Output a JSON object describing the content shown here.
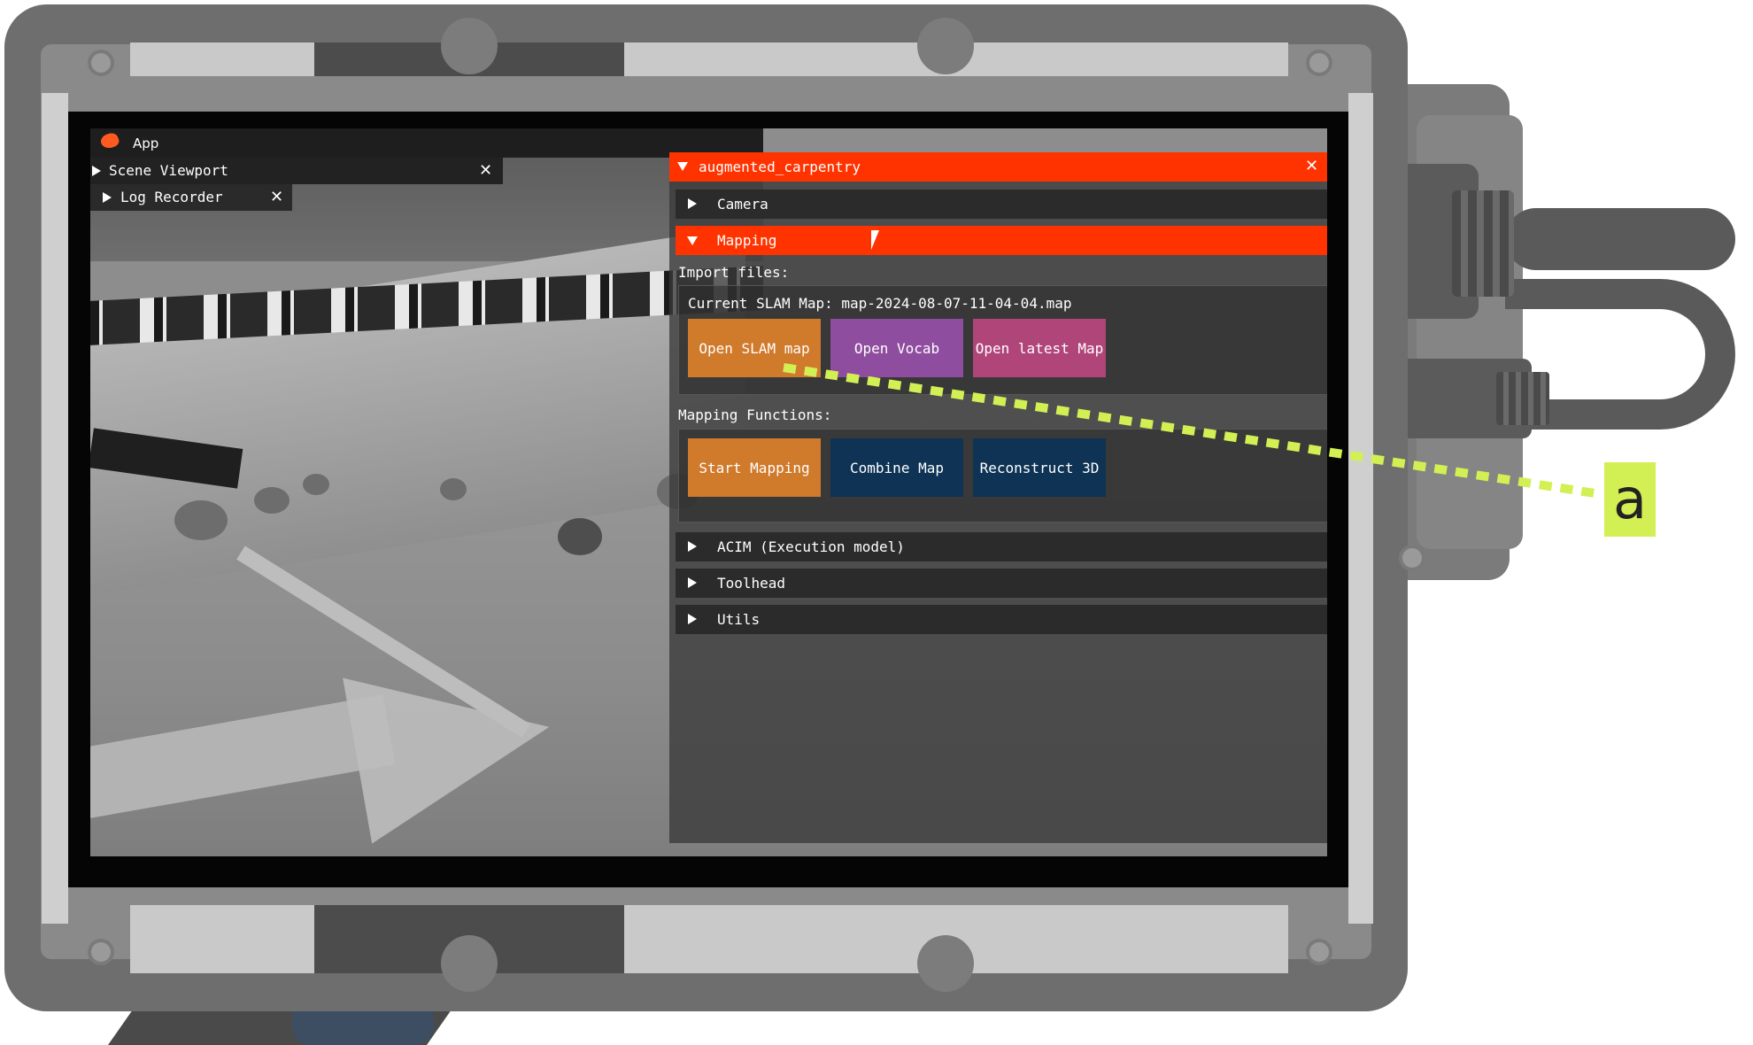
{
  "app_window": {
    "title": "App",
    "tabs": [
      {
        "label": "Scene Viewport",
        "close": "✕"
      },
      {
        "label": "Log Recorder",
        "close": "✕"
      }
    ]
  },
  "panel": {
    "title": "augmented_carpentry",
    "close": "✕",
    "sections": {
      "camera": "Camera",
      "mapping": "Mapping",
      "acim": "ACIM (Execution model)",
      "toolhead": "Toolhead",
      "utils": "Utils"
    },
    "mapping": {
      "import_label": "Import files:",
      "current_map": "Current SLAM Map: map-2024-08-07-11-04-04.map",
      "import_buttons": [
        {
          "label": "Open SLAM map",
          "color": "#d07a2c"
        },
        {
          "label": "Open Vocab",
          "color": "#8e4d9e"
        },
        {
          "label": "Open latest Map",
          "color": "#b0457a"
        }
      ],
      "functions_label": "Mapping Functions:",
      "function_buttons": [
        {
          "label": "Start Mapping",
          "color": "#d07a2c"
        },
        {
          "label": "Combine Map",
          "color": "#0e3355"
        },
        {
          "label": "Reconstruct 3D",
          "color": "#0e3355"
        }
      ]
    }
  },
  "annotation": {
    "label": "a",
    "color": "#d2ef54"
  },
  "colors": {
    "accent": "#ff3300",
    "housing": "#6e6e6e"
  }
}
